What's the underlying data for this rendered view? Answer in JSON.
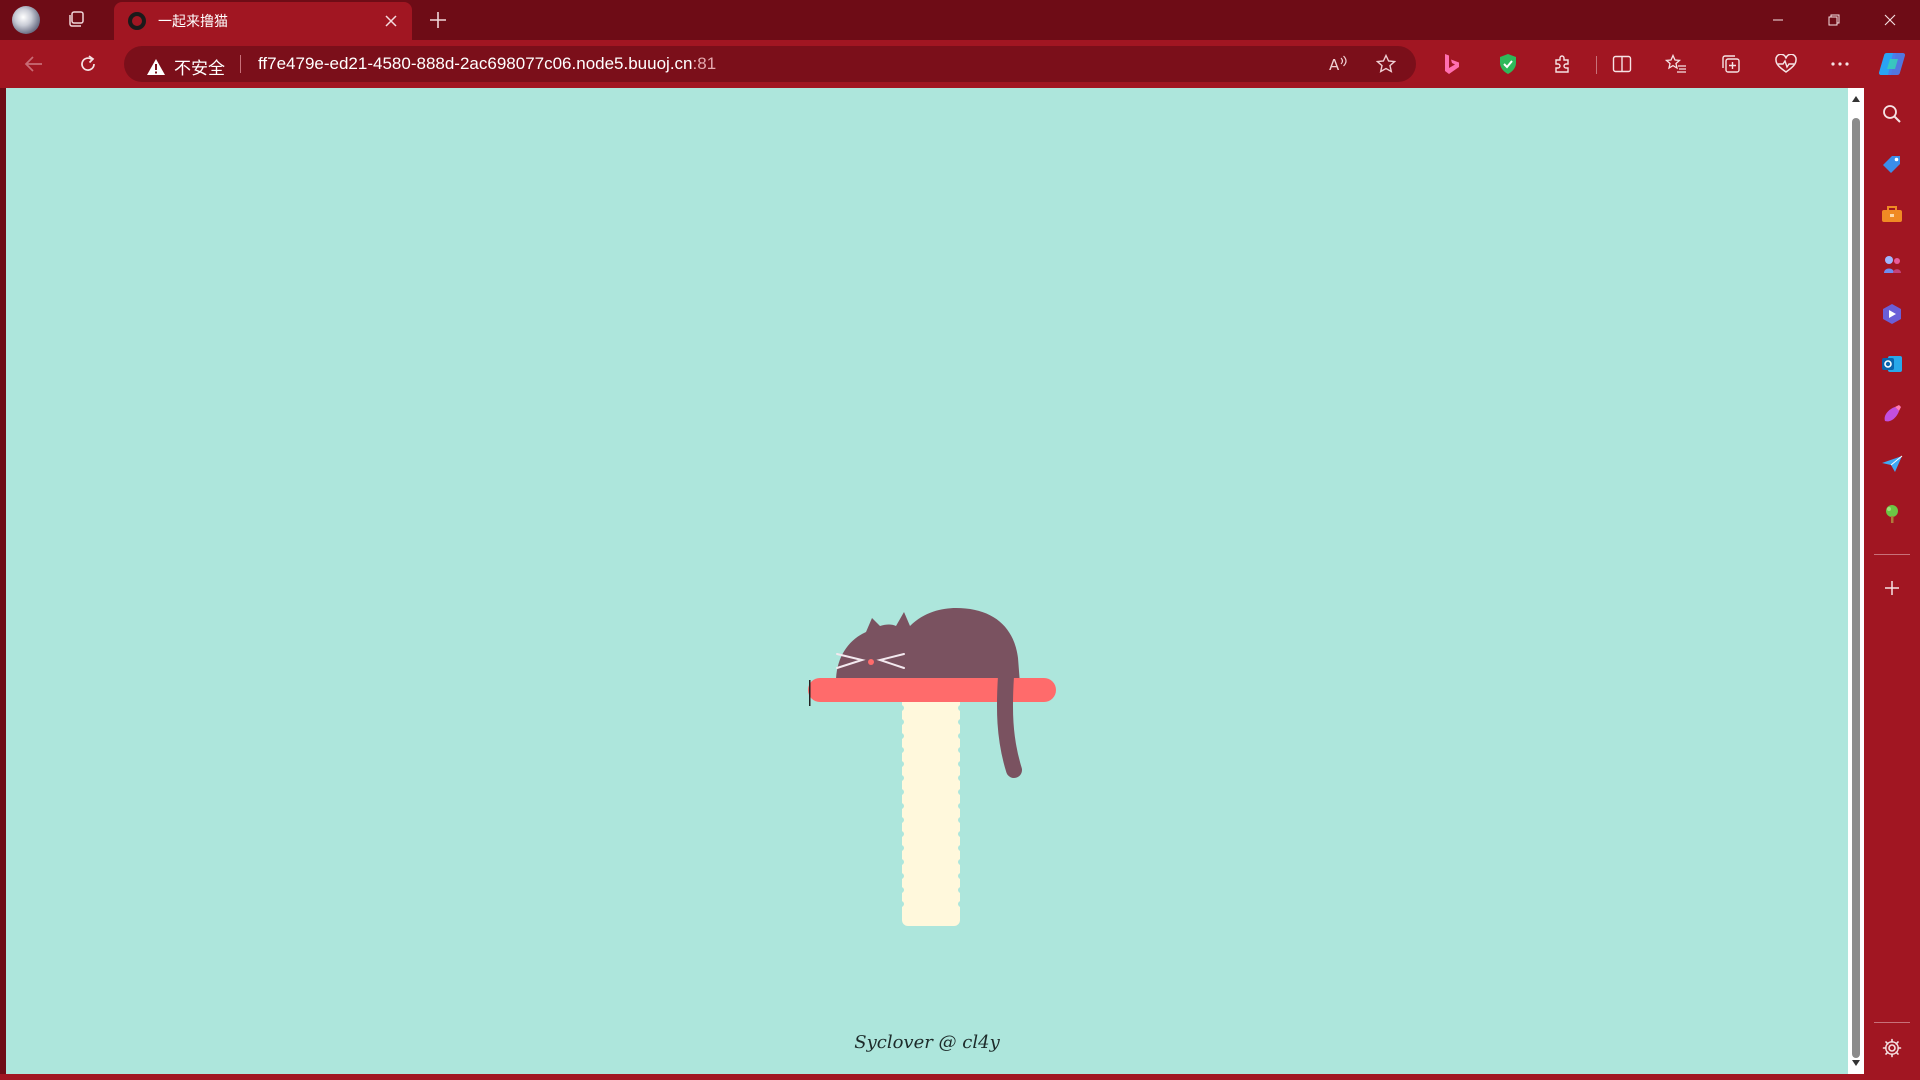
{
  "browser": {
    "tab": {
      "title": "一起来撸猫",
      "favicon": "cat-face-icon"
    },
    "new_tab_icon": "plus-icon",
    "window_controls": [
      "minimize-icon",
      "restore-icon",
      "close-icon"
    ]
  },
  "toolbar": {
    "security_label": "不安全",
    "url_host": "ff7e479e-ed21-4580-888d-2ac698077c06.node5.buuoj.cn",
    "url_port": ":81",
    "colors": {
      "frame": "#6e0c16",
      "toolbar": "#a11622",
      "addressbar": "#7b0f1a"
    }
  },
  "page": {
    "background": "#ade6dc",
    "footer": "Syclover @ cl4y",
    "illustration": {
      "cat_color": "#7a5260",
      "shelf_color": "#ff6b6b",
      "post_color": "#fff8dc"
    }
  },
  "sidebar": {
    "items": [
      "search-icon",
      "shopping-tag-icon",
      "toolbox-icon",
      "games-icon",
      "microsoft365-icon",
      "outlook-icon",
      "designer-icon",
      "send-icon",
      "tree-icon"
    ],
    "add_icon": "plus-icon",
    "settings_icon": "gear-icon"
  }
}
